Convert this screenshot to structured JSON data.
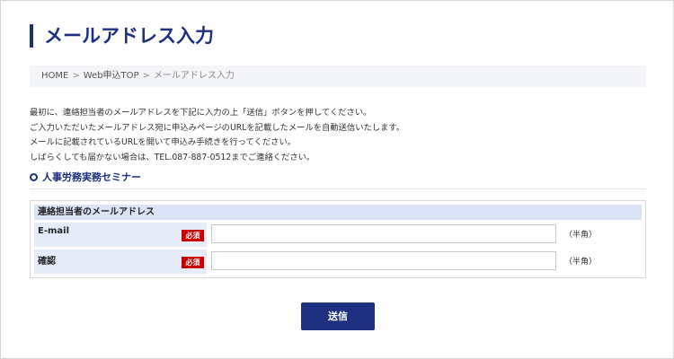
{
  "page": {
    "title": "メールアドレス入力"
  },
  "breadcrumb": {
    "items": [
      "HOME",
      "Web申込TOP",
      "メールアドレス入力"
    ],
    "separator": ">"
  },
  "intro": {
    "lines": [
      "最初に、連絡担当者のメールアドレスを下記に入力の上「送信」ボタンを押してください。",
      "ご入力いただいたメールアドレス宛に申込みページのURLを記載したメールを自動送信いたします。",
      "メールに記載されているURLを開いて申込み手続きを行ってください。",
      "しばらくしても届かない場合は、TEL.087-887-0512までご連絡ください。"
    ]
  },
  "section": {
    "title": "人事労務実務セミナー"
  },
  "form": {
    "header": "連絡担当者のメールアドレス",
    "required_label": "必須",
    "fields": [
      {
        "label": "E-mail",
        "value": "",
        "placeholder": "",
        "hint": "（半角）"
      },
      {
        "label": "確認",
        "value": "",
        "placeholder": "",
        "hint": "（半角）"
      }
    ]
  },
  "submit": {
    "label": "送信"
  },
  "colors": {
    "brand": "#1e2f7f",
    "required_badge": "#c80000",
    "label_bg": "#e6ebf8",
    "header_bg": "#dce3f6"
  }
}
